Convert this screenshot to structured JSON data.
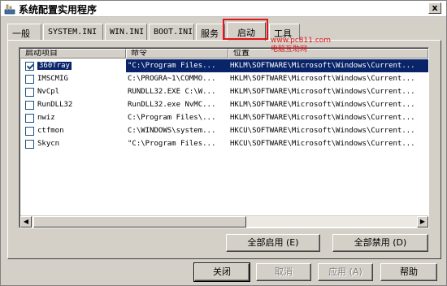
{
  "window": {
    "title": "系统配置实用程序",
    "close_symbol": "x"
  },
  "tabs": [
    {
      "label": "一般"
    },
    {
      "label": "SYSTEM.INI"
    },
    {
      "label": "WIN.INI"
    },
    {
      "label": "BOOT.INI"
    },
    {
      "label": "服务"
    },
    {
      "label": "启动"
    },
    {
      "label": "工具"
    }
  ],
  "active_tab": "启动",
  "watermark": {
    "url": "www.pc811.com",
    "text": "电脑互助网"
  },
  "list": {
    "columns": [
      "启动项目",
      "命令",
      "位置"
    ],
    "rows": [
      {
        "checked": true,
        "name": "360Tray",
        "command": "\"C:\\Program Files...",
        "location": "HKLM\\SOFTWARE\\Microsoft\\Windows\\Current..."
      },
      {
        "checked": false,
        "name": "IMSCMIG",
        "command": "C:\\PROGRA~1\\COMMO...",
        "location": "HKLM\\SOFTWARE\\Microsoft\\Windows\\Current..."
      },
      {
        "checked": false,
        "name": "NvCpl",
        "command": "RUNDLL32.EXE C:\\W...",
        "location": "HKLM\\SOFTWARE\\Microsoft\\Windows\\Current..."
      },
      {
        "checked": false,
        "name": "RunDLL32",
        "command": "RunDLL32.exe NvMC...",
        "location": "HKLM\\SOFTWARE\\Microsoft\\Windows\\Current..."
      },
      {
        "checked": false,
        "name": "nwiz",
        "command": "C:\\Program Files\\...",
        "location": "HKLM\\SOFTWARE\\Microsoft\\Windows\\Current..."
      },
      {
        "checked": false,
        "name": "ctfmon",
        "command": "C:\\WINDOWS\\system...",
        "location": "HKCU\\SOFTWARE\\Microsoft\\Windows\\Current..."
      },
      {
        "checked": false,
        "name": "Skycn",
        "command": "\"C:\\Program Files...",
        "location": "HKCU\\SOFTWARE\\Microsoft\\Windows\\Current..."
      }
    ]
  },
  "buttons": {
    "enable_all": "全部启用 (E)",
    "disable_all": "全部禁用 (D)",
    "close": "关闭",
    "cancel": "取消",
    "apply": "应用 (A)",
    "help": "帮助"
  },
  "colors": {
    "highlight_box": "#e3131b",
    "selection": "#0a246a",
    "dialog_bg": "#d4d0c8"
  },
  "scroll": {
    "left_arrow": "◀",
    "right_arrow": "▶"
  }
}
